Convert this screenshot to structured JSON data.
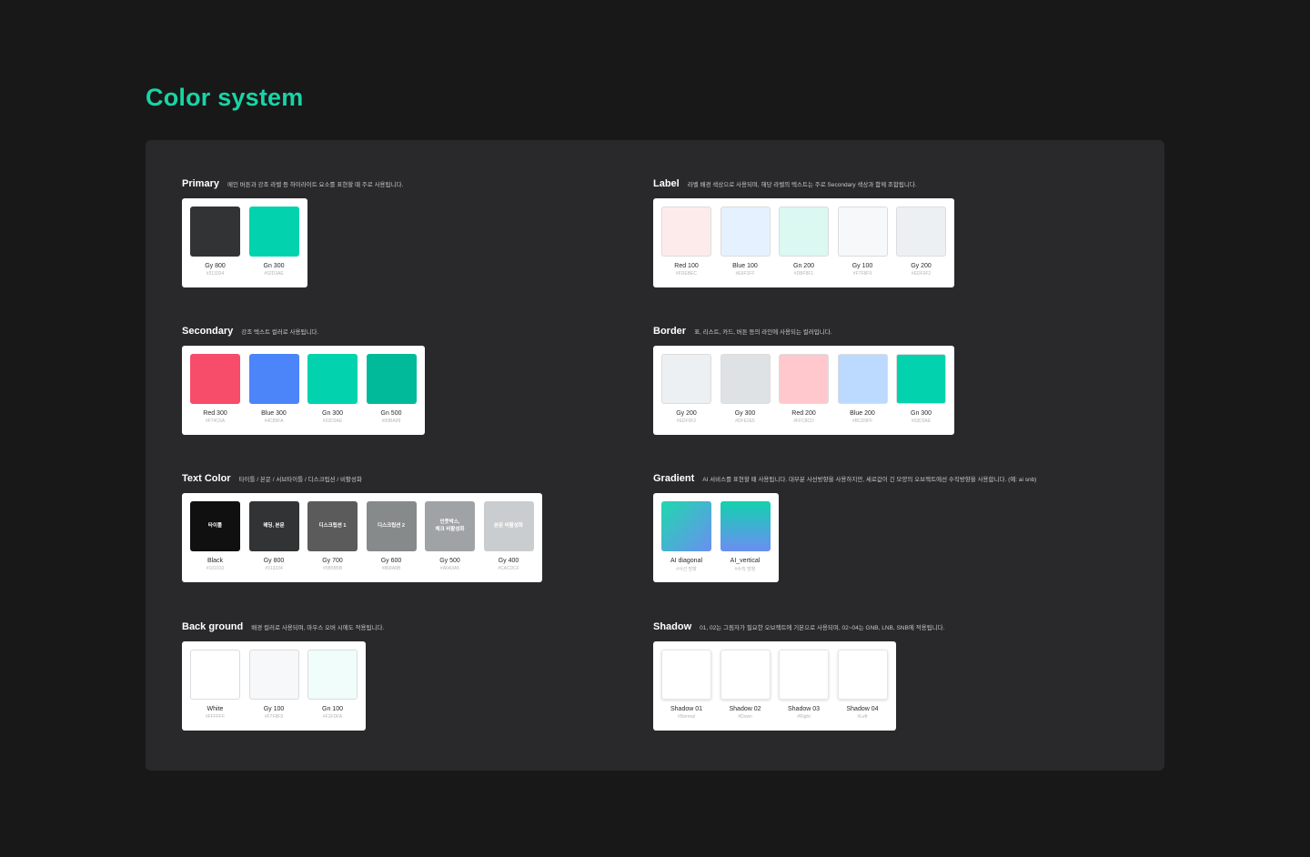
{
  "page": {
    "title": "Color system"
  },
  "groups": {
    "primary": {
      "title": "Primary",
      "desc": "메인 버튼과 강조 라벨 등 하이라이트 요소를 표현할 때 주로 사용됩니다.",
      "swatches": [
        {
          "name": "Gy 800",
          "hex": "#313334",
          "color": "#313334"
        },
        {
          "name": "Gn 300",
          "hex": "#02D3AE",
          "color": "#02D3AE"
        }
      ]
    },
    "label": {
      "title": "Label",
      "desc": "라벨 배경 색상으로 사용되며, 해당 라벨의 텍스트는 주로 Secondary 색상과 함께 조합됩니다.",
      "swatches": [
        {
          "name": "Red 100",
          "hex": "#FDEBEC",
          "color": "#FDEBEC"
        },
        {
          "name": "Blue 100",
          "hex": "#E6F1FF",
          "color": "#E6F1FF"
        },
        {
          "name": "Gn 200",
          "hex": "#DBF8F1",
          "color": "#DBF8F1"
        },
        {
          "name": "Gy 100",
          "hex": "#F7F8F9",
          "color": "#F7F8F9"
        },
        {
          "name": "Gy 200",
          "hex": "#EDF0F2",
          "color": "#EDF0F2"
        }
      ]
    },
    "secondary": {
      "title": "Secondary",
      "desc": "강조 텍스트 컬러로 사용됩니다.",
      "swatches": [
        {
          "name": "Red 300",
          "hex": "#F74C6A",
          "color": "#F74C6A"
        },
        {
          "name": "Blue 300",
          "hex": "#4C85FA",
          "color": "#4C85FA"
        },
        {
          "name": "Gn 300",
          "hex": "#02D3AE",
          "color": "#02D3AE"
        },
        {
          "name": "Gn 500",
          "hex": "#00BA99",
          "color": "#00BA99"
        }
      ]
    },
    "border": {
      "title": "Border",
      "desc": "표, 리스트, 카드, 버튼 등의 라인에 사용되는 컬러입니다.",
      "swatches": [
        {
          "name": "Gy 200",
          "hex": "#EDF0F2",
          "color": "#EDF0F2"
        },
        {
          "name": "Gy 300",
          "hex": "#DFE2E5",
          "color": "#DFE2E5"
        },
        {
          "name": "Red 200",
          "hex": "#FFC8CD",
          "color": "#FFC8CD"
        },
        {
          "name": "Blue 200",
          "hex": "#BCD9FF",
          "color": "#BCD9FF"
        },
        {
          "name": "Gn 300",
          "hex": "#02D3AE",
          "color": "#02D3AE"
        }
      ]
    },
    "text_color": {
      "title": "Text Color",
      "desc": "타이틀 / 본문 / 서브타이틀 / 디스크립션 / 비활성화",
      "swatches": [
        {
          "name": "Black",
          "hex": "#101010",
          "color": "#101010",
          "label": "타이틀"
        },
        {
          "name": "Gy 800",
          "hex": "#313334",
          "color": "#313334",
          "label": "헤딩, 본문"
        },
        {
          "name": "Gy 700",
          "hex": "#5B5B5B",
          "color": "#5B5B5B",
          "label": "디스크립션 1"
        },
        {
          "name": "Gy 600",
          "hex": "#868A8B",
          "color": "#868A8B",
          "label": "디스크립션 2"
        },
        {
          "name": "Gy 500",
          "hex": "#A0A3A5",
          "color": "#A0A3A5",
          "label": "인풋박스,\n체크 비활성화"
        },
        {
          "name": "Gy 400",
          "hex": "#CACDCF",
          "color": "#CACDCF",
          "label": "본문 비활성화"
        }
      ]
    },
    "gradient": {
      "title": "Gradient",
      "desc": "AI 서비스를 표현할 때 사용됩니다. 대부분 사선방향을 사용하지만, 세로값이 긴 모양의 오브젝트에선 수직방향을 사용합니다. (예: ai snb)",
      "swatches": [
        {
          "name": "AI diagonal",
          "hex": "#사선 방향",
          "color": "linear-gradient(135deg, #1fd8ad 0%, #6a8ff1 100%)"
        },
        {
          "name": "AI_vertical",
          "hex": "#수직 방향",
          "color": "linear-gradient(180deg, #12d2ae 0%, #6c8df3 100%)"
        }
      ]
    },
    "background": {
      "title": "Back ground",
      "desc": "배경 컬러로 사용되며, 마우스 오버 시에도 적용됩니다.",
      "swatches": [
        {
          "name": "White",
          "hex": "#FFFFFF",
          "color": "#FFFFFF"
        },
        {
          "name": "Gy 100",
          "hex": "#F7F8F9",
          "color": "#F7F8F9"
        },
        {
          "name": "Gn 100",
          "hex": "#F1FDFA",
          "color": "#F1FDFA"
        }
      ]
    },
    "shadow": {
      "title": "Shadow",
      "desc": "01, 02는 그림자가 필요한 오브젝트에 기본으로 사용되며, 02~04는 GNB, LNB, SNB에 적용됩니다.",
      "swatches": [
        {
          "name": "Shadow 01",
          "hex": "#Normal",
          "color": "#FFFFFF"
        },
        {
          "name": "Shadow 02",
          "hex": "#Down",
          "color": "#FFFFFF"
        },
        {
          "name": "Shadow 03",
          "hex": "#Right",
          "color": "#FFFFFF"
        },
        {
          "name": "Shadow 04",
          "hex": "#Left",
          "color": "#FFFFFF"
        }
      ]
    }
  }
}
